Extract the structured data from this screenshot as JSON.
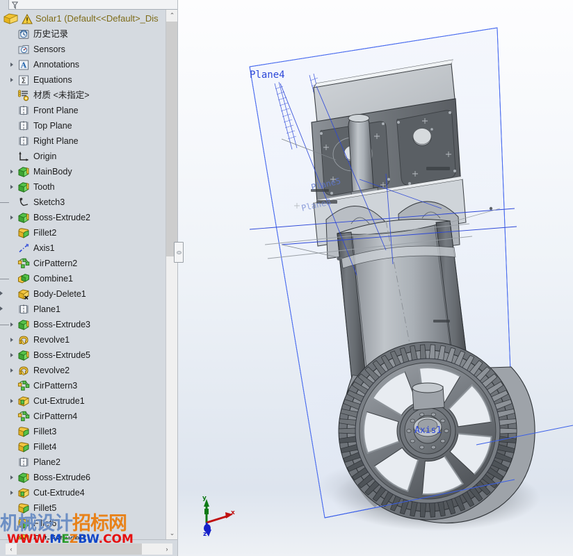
{
  "app": {
    "kind": "cad-feature-manager",
    "accent_blue": "#2b46d8",
    "root_text_color": "#7d6b18",
    "panel_bg": "#d5dae0",
    "viewport_bg_top": "#fdfdfe",
    "viewport_bg_bottom": "#dde4ee"
  },
  "filter_bar": {
    "icon": "funnel-filter-icon",
    "value": "",
    "placeholder": ""
  },
  "tree": {
    "root": {
      "part_icon": "part-document-icon",
      "warning_icon": "warning-triangle-icon",
      "label": "Solar1  (Default<<Default>_Dis"
    },
    "items": [
      {
        "label": "历史记录",
        "icon": "history-icon",
        "twisty": false,
        "stub": "none"
      },
      {
        "label": "Sensors",
        "icon": "sensors-icon",
        "twisty": false,
        "stub": "none"
      },
      {
        "label": "Annotations",
        "icon": "annotations-icon",
        "twisty": true,
        "stub": "none"
      },
      {
        "label": "Equations",
        "icon": "equations-icon",
        "twisty": true,
        "stub": "none"
      },
      {
        "label": "材质 <未指定>",
        "icon": "material-icon",
        "twisty": false,
        "stub": "none"
      },
      {
        "label": "Front Plane",
        "icon": "plane-icon",
        "twisty": false,
        "stub": "none"
      },
      {
        "label": "Top Plane",
        "icon": "plane-icon",
        "twisty": false,
        "stub": "none"
      },
      {
        "label": "Right Plane",
        "icon": "plane-icon",
        "twisty": false,
        "stub": "none"
      },
      {
        "label": "Origin",
        "icon": "origin-icon",
        "twisty": false,
        "stub": "none"
      },
      {
        "label": "MainBody",
        "icon": "boss-extrude-icon",
        "twisty": true,
        "stub": "none"
      },
      {
        "label": "Tooth",
        "icon": "boss-extrude-icon",
        "twisty": true,
        "stub": "none"
      },
      {
        "label": "Sketch3",
        "icon": "sketch-icon",
        "twisty": false,
        "stub": "line"
      },
      {
        "label": "Boss-Extrude2",
        "icon": "boss-extrude-icon",
        "twisty": true,
        "stub": "none"
      },
      {
        "label": "Fillet2",
        "icon": "fillet-icon",
        "twisty": false,
        "stub": "none"
      },
      {
        "label": "Axis1",
        "icon": "axis-icon",
        "twisty": false,
        "stub": "none"
      },
      {
        "label": "CirPattern2",
        "icon": "cir-pattern-icon",
        "twisty": false,
        "stub": "none"
      },
      {
        "label": "Combine1",
        "icon": "combine-icon",
        "twisty": false,
        "stub": "line"
      },
      {
        "label": "Body-Delete1",
        "icon": "body-delete-icon",
        "twisty": false,
        "stub": "arrow"
      },
      {
        "label": "Plane1",
        "icon": "plane-icon",
        "twisty": false,
        "stub": "arrow"
      },
      {
        "label": "Boss-Extrude3",
        "icon": "boss-extrude-icon",
        "twisty": true,
        "stub": "line"
      },
      {
        "label": "Revolve1",
        "icon": "revolve-icon",
        "twisty": true,
        "stub": "none"
      },
      {
        "label": "Boss-Extrude5",
        "icon": "boss-extrude-icon",
        "twisty": true,
        "stub": "none"
      },
      {
        "label": "Revolve2",
        "icon": "revolve-icon",
        "twisty": true,
        "stub": "none"
      },
      {
        "label": "CirPattern3",
        "icon": "cir-pattern-icon",
        "twisty": false,
        "stub": "none"
      },
      {
        "label": "Cut-Extrude1",
        "icon": "cut-extrude-icon",
        "twisty": true,
        "stub": "none"
      },
      {
        "label": "CirPattern4",
        "icon": "cir-pattern-icon",
        "twisty": false,
        "stub": "none"
      },
      {
        "label": "Fillet3",
        "icon": "fillet-icon",
        "twisty": false,
        "stub": "none"
      },
      {
        "label": "Fillet4",
        "icon": "fillet-icon",
        "twisty": false,
        "stub": "none"
      },
      {
        "label": "Plane2",
        "icon": "plane-icon",
        "twisty": false,
        "stub": "none"
      },
      {
        "label": "Boss-Extrude6",
        "icon": "boss-extrude-icon",
        "twisty": true,
        "stub": "none"
      },
      {
        "label": "Cut-Extrude4",
        "icon": "cut-extrude-icon",
        "twisty": true,
        "stub": "none"
      },
      {
        "label": "Fillet5",
        "icon": "fillet-icon",
        "twisty": false,
        "stub": "none"
      },
      {
        "label": "Fillet6",
        "icon": "fillet-icon",
        "twisty": false,
        "stub": "none"
      },
      {
        "label": "Cut-Extrude8",
        "icon": "cut-extrude-icon",
        "twisty": false,
        "stub": "none"
      }
    ]
  },
  "scrollbars": {
    "vertical": {
      "up_glyph": "⌃",
      "down_glyph": "⌄"
    },
    "horizontal": {
      "left_glyph": "‹",
      "right_glyph": "›"
    }
  },
  "splitter": {
    "name": "panel-splitter-handle"
  },
  "viewport": {
    "labels": {
      "plane4": "Plane4",
      "plane5": "Plane5",
      "plane8": "Plane8",
      "axis1": "Axis1"
    },
    "triad": {
      "x": "x",
      "y": "y",
      "z": "z",
      "x_color": "#c01010",
      "y_color": "#0f7a16",
      "z_color": "#1520c8"
    },
    "selection_box_color": "#3a5fe8",
    "model_description": "motor-gearbox-assembly-with-spoked-gear"
  },
  "watermark": {
    "cn_part1": "机械设",
    "cn_part2": "计",
    "cn_part3": "招标网",
    "url_w": "WWW.",
    "url_m": "M",
    "url_e": "E",
    "url_z": "Z",
    "url_b": "B",
    "url_w2": "W",
    "url_com": ".COM"
  }
}
